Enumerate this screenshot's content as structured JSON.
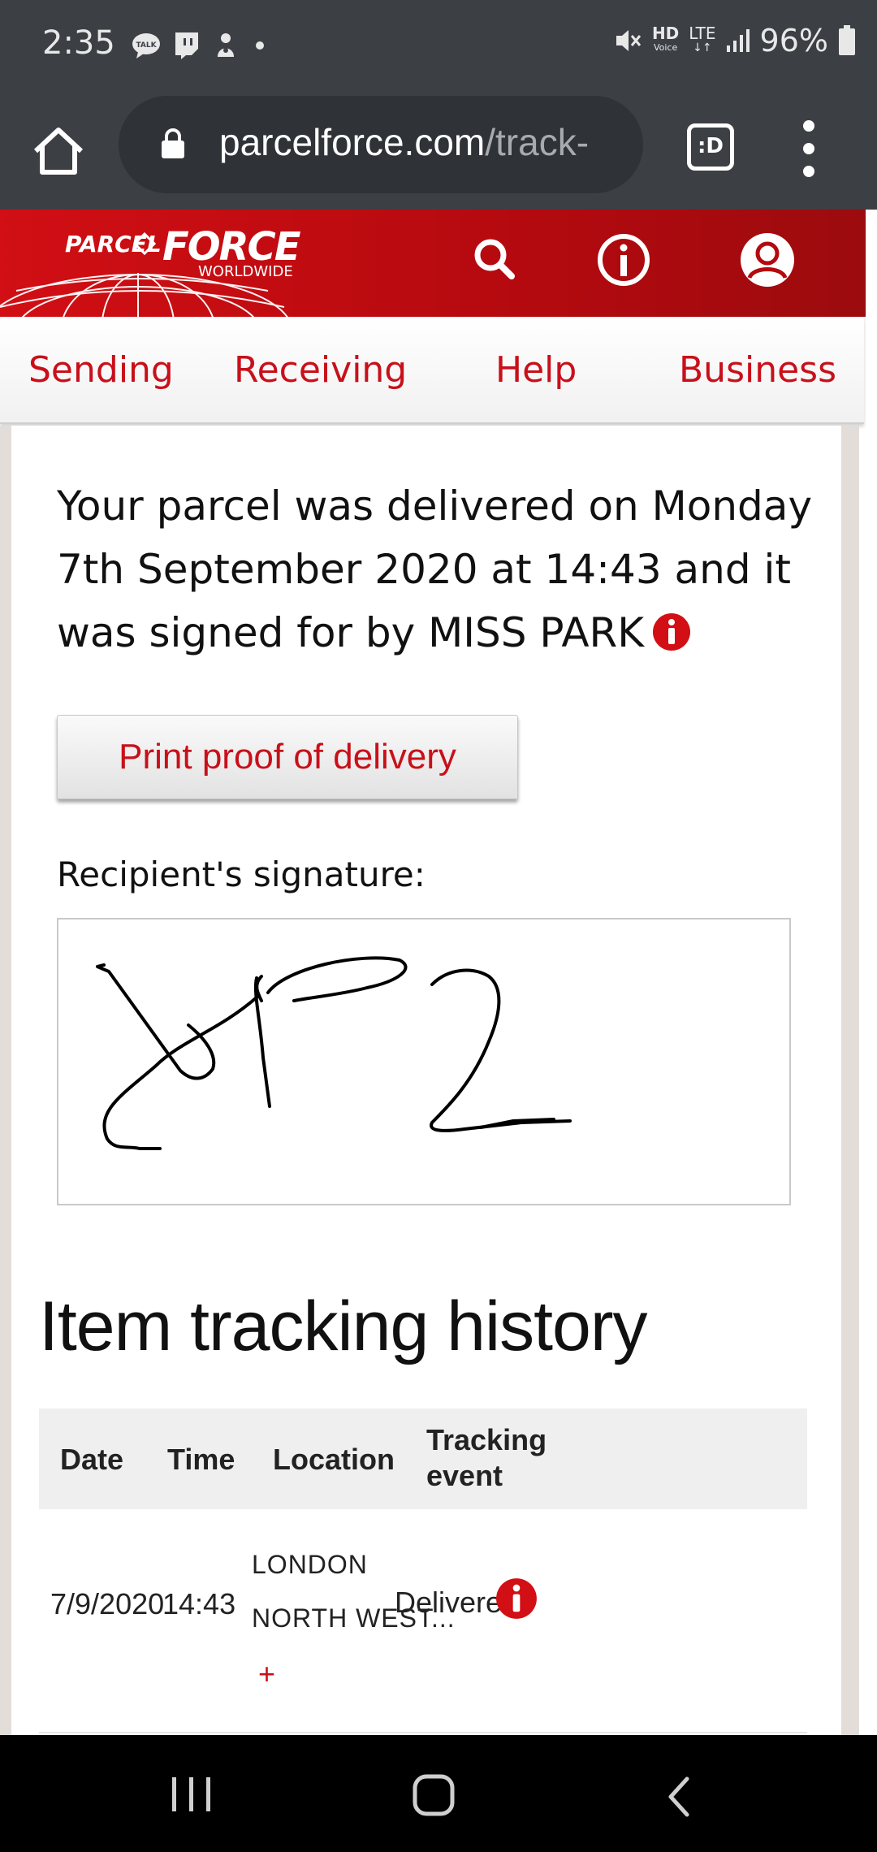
{
  "status_bar": {
    "time": "2:35",
    "battery": "96%",
    "icons": [
      "talk-icon",
      "twitch-icon",
      "app-icon",
      "dot-icon",
      "mute-icon",
      "hd-voice-icon",
      "lte-icon",
      "signal-icon",
      "battery-icon"
    ],
    "hd_voice_label": "HD",
    "lte_label": "LTE"
  },
  "browser": {
    "url_host": "parcelforce.com",
    "url_path": "/track-",
    "tab_count_label": ":D"
  },
  "brand": {
    "logo_line1": "PARCEL",
    "logo_line2": "FORCE",
    "logo_sub": "WORLDWIDE",
    "colors": {
      "primary": "#d10f14",
      "dark": "#9c0b0e"
    }
  },
  "nav": {
    "items": [
      "Sending",
      "Receiving",
      "Help",
      "Business"
    ]
  },
  "delivery": {
    "message": "Your parcel was delivered on Monday 7th September 2020 at 14:43 and it was signed for by MISS PARK",
    "print_button": "Print proof of delivery",
    "signature_label": "Recipient's signature:"
  },
  "history": {
    "title": "Item tracking history",
    "columns": [
      "Date",
      "Time",
      "Location",
      "Tracking",
      "event"
    ],
    "rows": [
      {
        "date": "7/9/2020",
        "time": "14:43",
        "location_line1": "LONDON",
        "location_line2": "NORTH WEST...",
        "expand": "+",
        "event": "Delivered"
      }
    ]
  }
}
